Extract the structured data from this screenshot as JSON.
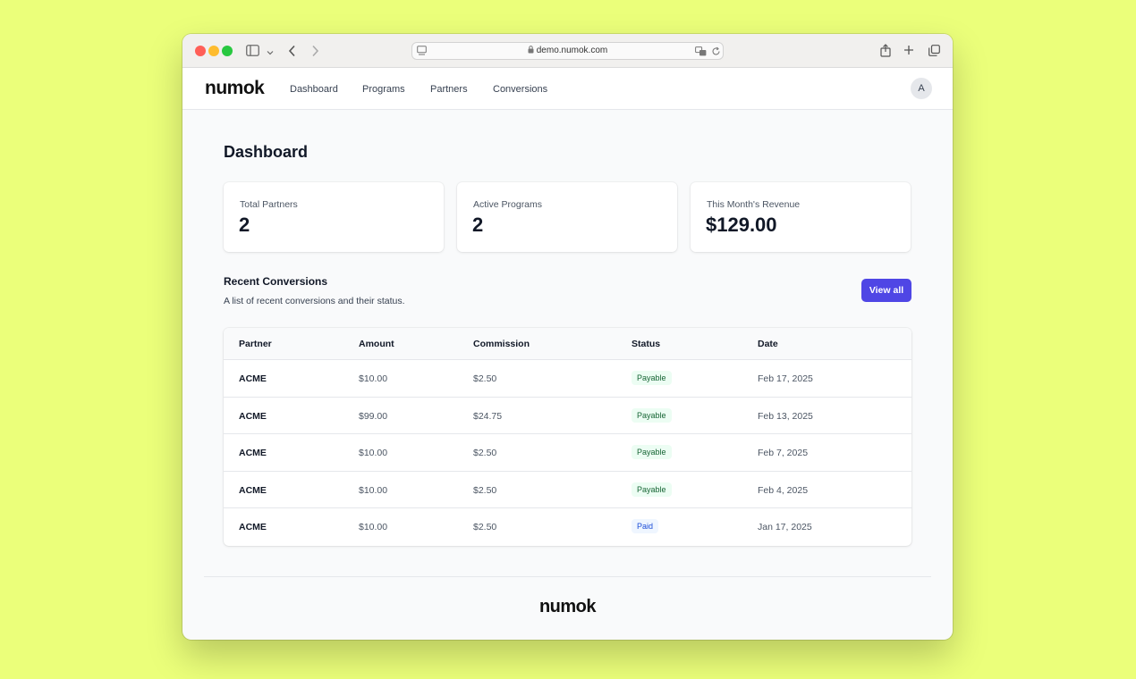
{
  "browser": {
    "url": "demo.numok.com",
    "icons": {
      "sidebar": "sidebar-icon",
      "chevron": "chevron-down-icon",
      "back": "back-arrow-icon",
      "forward": "forward-arrow-icon",
      "page": "page-menu-icon",
      "lock": "lock-icon",
      "translate": "translate-icon",
      "reload": "reload-icon",
      "share": "share-icon",
      "new_tab": "plus-icon",
      "tabs": "tabs-overview-icon"
    }
  },
  "nav": {
    "logo": "numok",
    "links": [
      "Dashboard",
      "Programs",
      "Partners",
      "Conversions"
    ],
    "avatar": "A"
  },
  "page": {
    "title": "Dashboard"
  },
  "stats": [
    {
      "label": "Total Partners",
      "value": "2"
    },
    {
      "label": "Active Programs",
      "value": "2"
    },
    {
      "label": "This Month's Revenue",
      "value": "$129.00"
    }
  ],
  "recent": {
    "title": "Recent Conversions",
    "description": "A list of recent conversions and their status.",
    "view_all": "View all",
    "columns": [
      "Partner",
      "Amount",
      "Commission",
      "Status",
      "Date"
    ],
    "rows": [
      {
        "partner": "ACME",
        "amount": "$10.00",
        "commission": "$2.50",
        "status": "Payable",
        "date": "Feb 17, 2025"
      },
      {
        "partner": "ACME",
        "amount": "$99.00",
        "commission": "$24.75",
        "status": "Payable",
        "date": "Feb 13, 2025"
      },
      {
        "partner": "ACME",
        "amount": "$10.00",
        "commission": "$2.50",
        "status": "Payable",
        "date": "Feb 7, 2025"
      },
      {
        "partner": "ACME",
        "amount": "$10.00",
        "commission": "$2.50",
        "status": "Payable",
        "date": "Feb 4, 2025"
      },
      {
        "partner": "ACME",
        "amount": "$10.00",
        "commission": "$2.50",
        "status": "Paid",
        "date": "Jan 17, 2025"
      }
    ]
  },
  "status_colors": {
    "Payable": {
      "bg": "#ecfdf3",
      "fg": "#166534"
    },
    "Paid": {
      "bg": "#eff6ff",
      "fg": "#1d4ed8"
    }
  },
  "colors": {
    "accent": "#4f46e5",
    "background": "#ebff7a"
  },
  "footer": {
    "logo": "numok"
  }
}
